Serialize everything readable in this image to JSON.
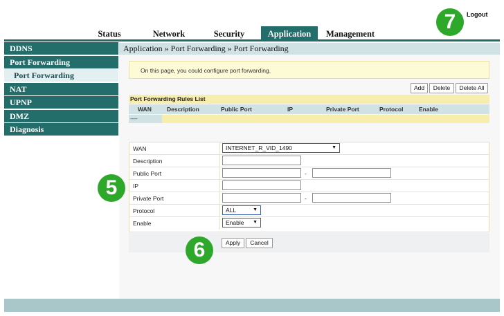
{
  "header": {
    "logout_label": "Logout"
  },
  "badges": {
    "top": "7",
    "middle": "5",
    "bottom": "6"
  },
  "nav": {
    "tabs": [
      "Status",
      "Network",
      "Security",
      "Application",
      "Management"
    ],
    "active": "Application"
  },
  "sidebar": {
    "items": [
      {
        "label": "DDNS"
      },
      {
        "label": "Port Forwarding"
      },
      {
        "label": "Port Forwarding",
        "sub": true
      },
      {
        "label": "NAT"
      },
      {
        "label": "UPNP"
      },
      {
        "label": "DMZ"
      },
      {
        "label": "Diagnosis"
      }
    ]
  },
  "breadcrumb": "Application » Port Forwarding » Port Forwarding",
  "info_text": "On this page, you could configure port forwarding.",
  "toolbar": {
    "add": "Add",
    "delete": "Delete",
    "delete_all": "Delete All"
  },
  "rules": {
    "title": "Port Forwarding Rules List",
    "columns": [
      "WAN",
      "Description",
      "Public Port",
      "IP",
      "Private Port",
      "Protocol",
      "Enable"
    ],
    "empty_cell": "----"
  },
  "form": {
    "wan_label": "WAN",
    "wan_value": "INTERNET_R_VID_1490",
    "description_label": "Description",
    "public_port_label": "Public Port",
    "ip_label": "IP",
    "private_port_label": "Private Port",
    "protocol_label": "Protocol",
    "protocol_value": "ALL",
    "enable_label": "Enable",
    "enable_value": "Enable",
    "range_sep": "-",
    "apply": "Apply",
    "cancel": "Cancel"
  },
  "colors": {
    "accent": "#236e6a",
    "light": "#d0e2e4",
    "yellow": "#f7eeae",
    "badge": "#2ea82a"
  }
}
